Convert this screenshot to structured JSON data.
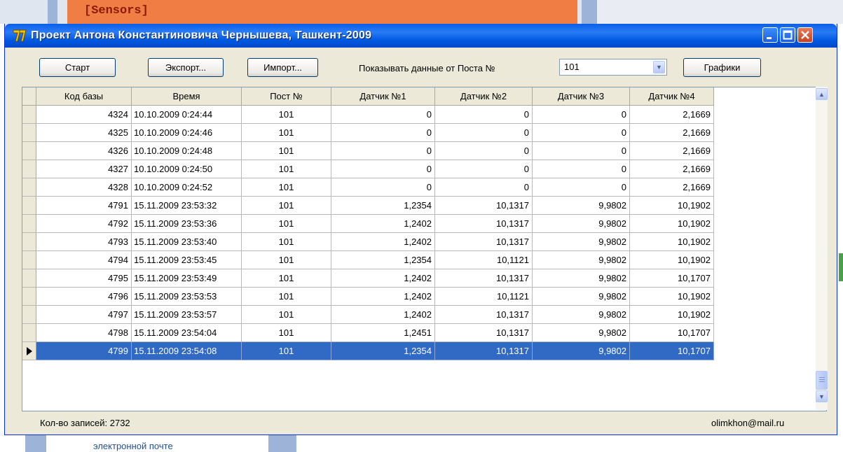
{
  "background": {
    "top_text": "[Sensors]",
    "bottom_text": "электронной почте"
  },
  "window": {
    "title": "Проект Антона Константиновича Чернышева, Ташкент-2009",
    "icon": "app-logo-icon"
  },
  "toolbar": {
    "start_label": "Старт",
    "export_label": "Экспорт...",
    "import_label": "Импорт...",
    "show_data_label": "Показывать данные от Поста №",
    "post_select_value": "101",
    "charts_label": "Графики"
  },
  "grid": {
    "columns": [
      "Код базы",
      "Время",
      "Пост №",
      "Датчик №1",
      "Датчик №2",
      "Датчик №3",
      "Датчик №4"
    ],
    "rows": [
      [
        "4324",
        "10.10.2009 0:24:44",
        "101",
        "0",
        "0",
        "0",
        "2,1669"
      ],
      [
        "4325",
        "10.10.2009 0:24:46",
        "101",
        "0",
        "0",
        "0",
        "2,1669"
      ],
      [
        "4326",
        "10.10.2009 0:24:48",
        "101",
        "0",
        "0",
        "0",
        "2,1669"
      ],
      [
        "4327",
        "10.10.2009 0:24:50",
        "101",
        "0",
        "0",
        "0",
        "2,1669"
      ],
      [
        "4328",
        "10.10.2009 0:24:52",
        "101",
        "0",
        "0",
        "0",
        "2,1669"
      ],
      [
        "4791",
        "15.11.2009 23:53:32",
        "101",
        "1,2354",
        "10,1317",
        "9,9802",
        "10,1902"
      ],
      [
        "4792",
        "15.11.2009 23:53:36",
        "101",
        "1,2402",
        "10,1317",
        "9,9802",
        "10,1902"
      ],
      [
        "4793",
        "15.11.2009 23:53:40",
        "101",
        "1,2402",
        "10,1317",
        "9,9802",
        "10,1902"
      ],
      [
        "4794",
        "15.11.2009 23:53:45",
        "101",
        "1,2354",
        "10,1121",
        "9,9802",
        "10,1902"
      ],
      [
        "4795",
        "15.11.2009 23:53:49",
        "101",
        "1,2402",
        "10,1317",
        "9,9802",
        "10,1707"
      ],
      [
        "4796",
        "15.11.2009 23:53:53",
        "101",
        "1,2402",
        "10,1121",
        "9,9802",
        "10,1902"
      ],
      [
        "4797",
        "15.11.2009 23:53:57",
        "101",
        "1,2402",
        "10,1317",
        "9,9802",
        "10,1902"
      ],
      [
        "4798",
        "15.11.2009 23:54:04",
        "101",
        "1,2451",
        "10,1317",
        "9,9802",
        "10,1707"
      ],
      [
        "4799",
        "15.11.2009 23:54:08",
        "101",
        "1,2354",
        "10,1317",
        "9,9802",
        "10,1707"
      ]
    ],
    "selected_row": 13
  },
  "status": {
    "records": "Кол-во записей: 2732",
    "email": "olimkhon@mail.ru"
  }
}
